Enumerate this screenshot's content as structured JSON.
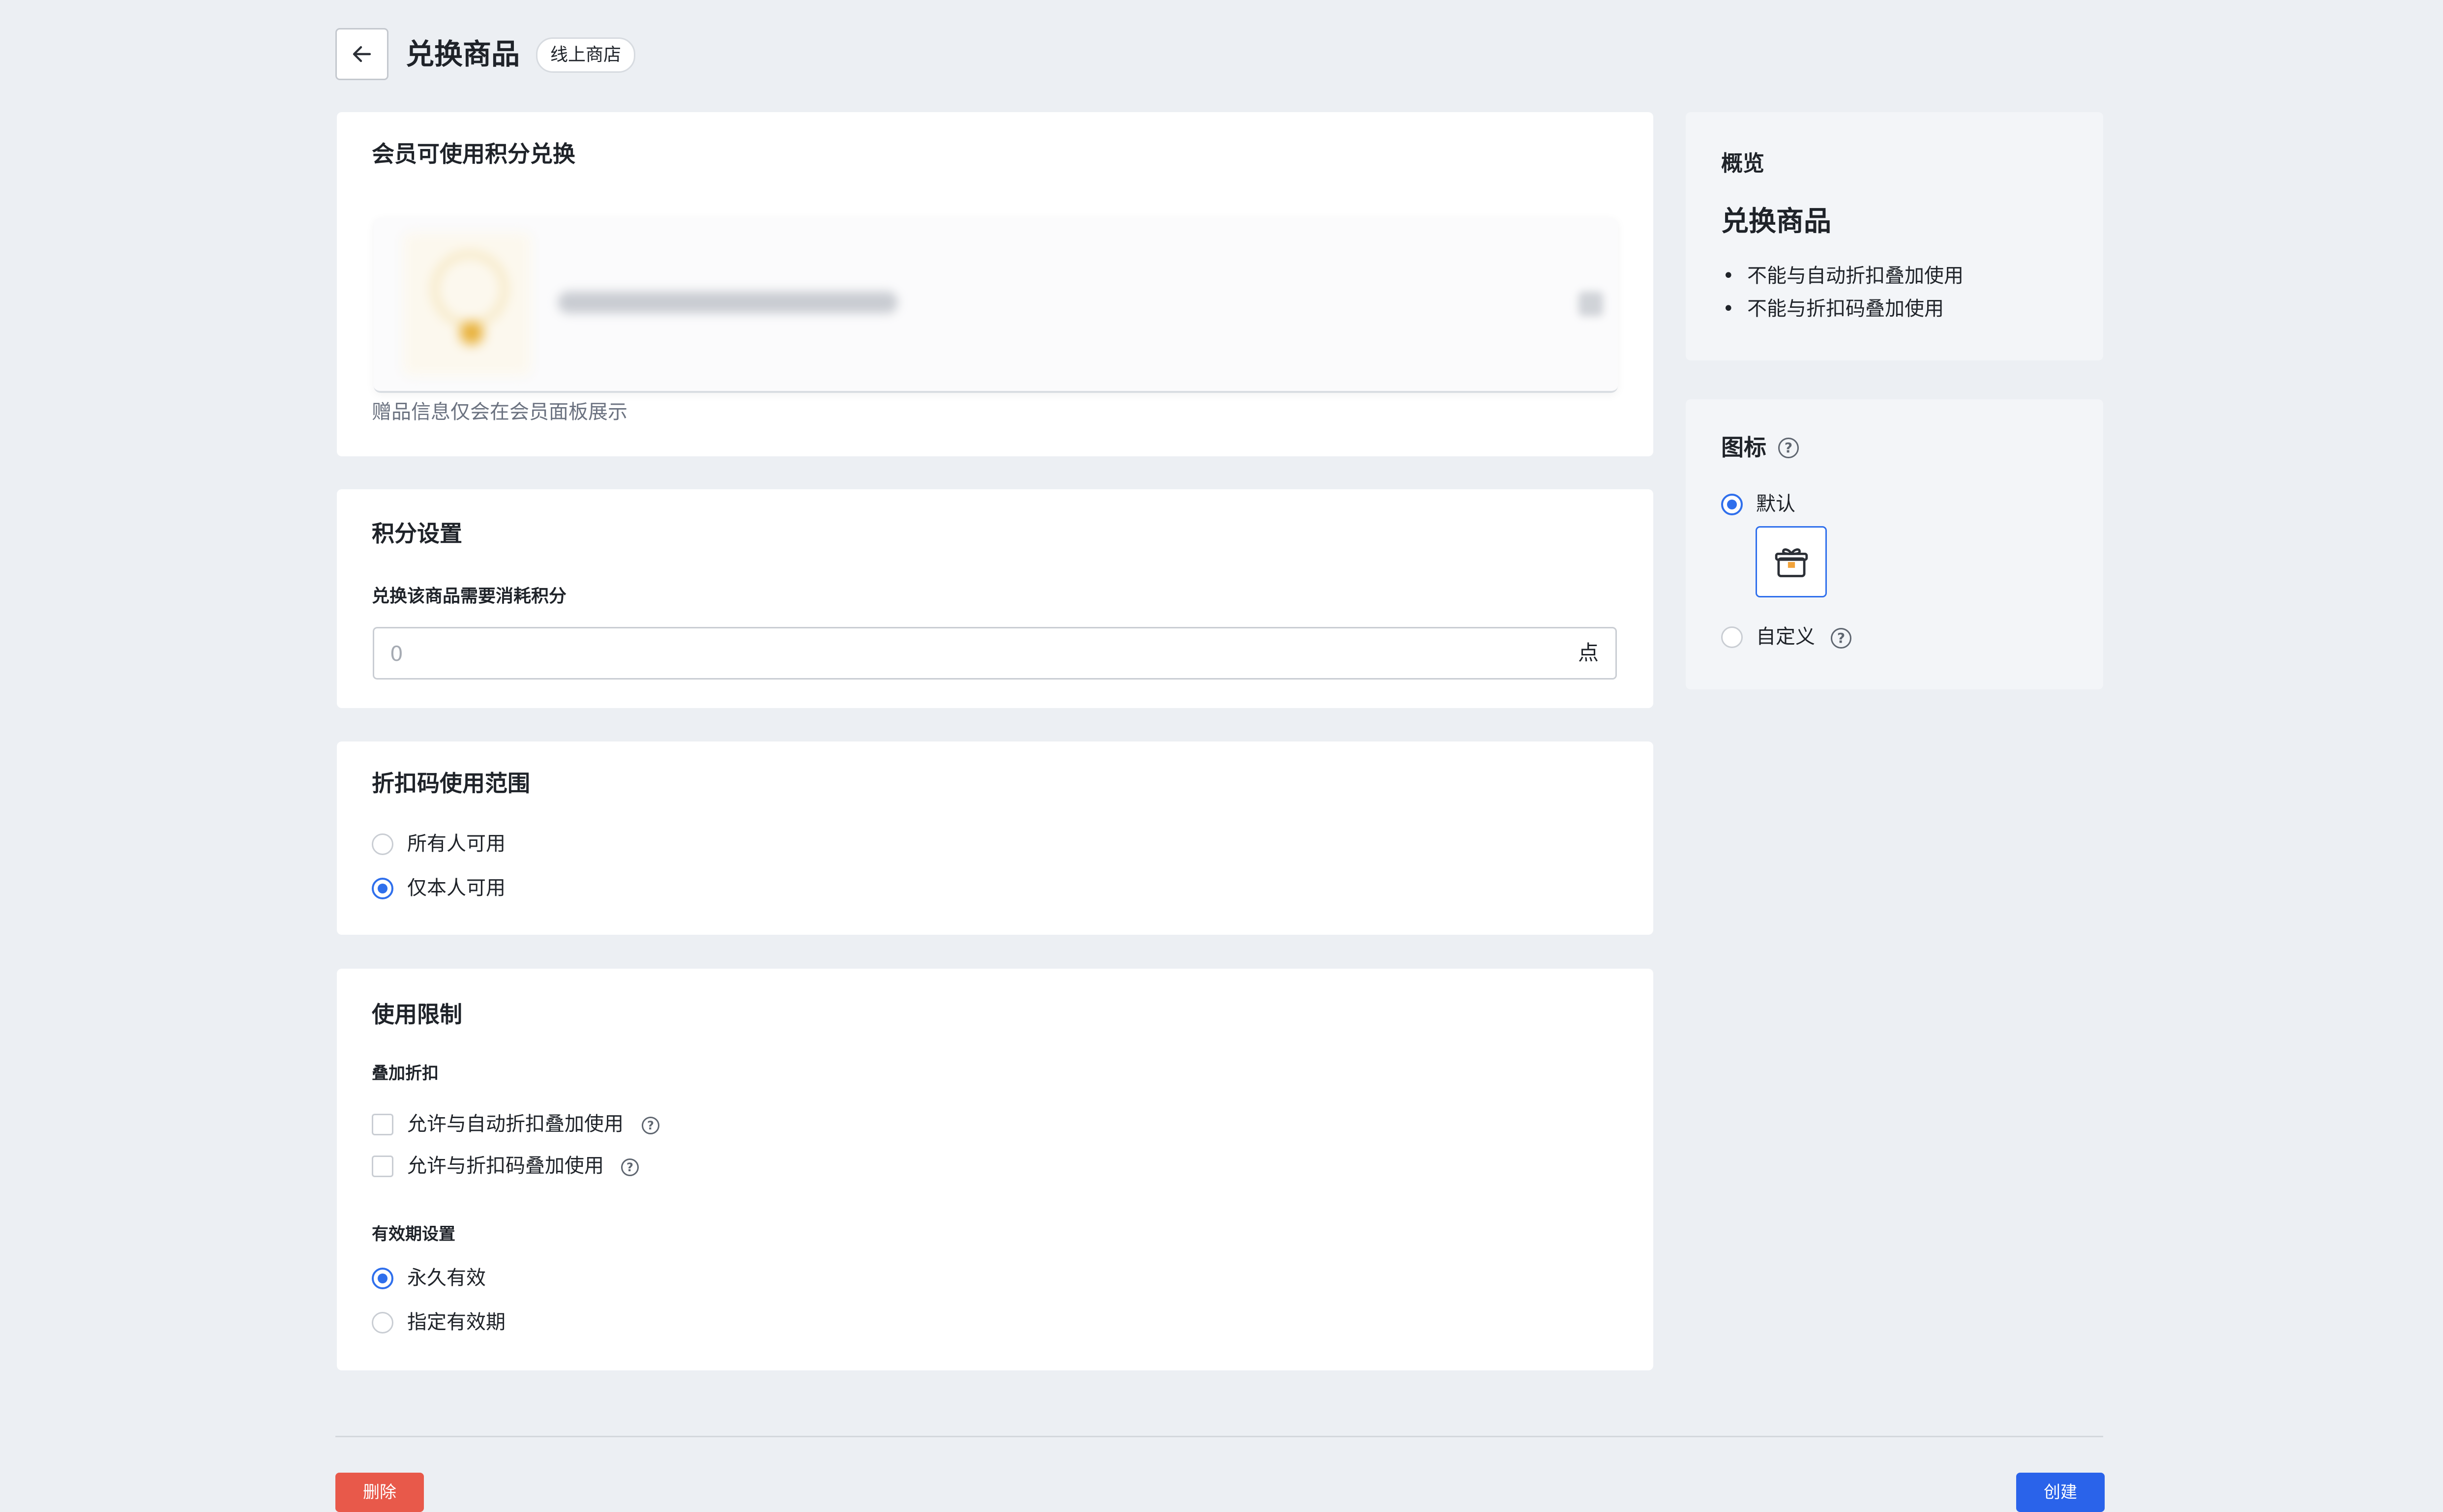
{
  "header": {
    "title": "兑换商品",
    "badge": "线上商店"
  },
  "redeem_card": {
    "title": "会员可使用积分兑换",
    "hint": "赠品信息仅会在会员面板展示"
  },
  "points_card": {
    "title": "积分设置",
    "field_label": "兑换该商品需要消耗积分",
    "field_placeholder": "0",
    "field_suffix": "点"
  },
  "scope_card": {
    "title": "折扣码使用范围",
    "options": [
      {
        "label": "所有人可用",
        "selected": false
      },
      {
        "label": "仅本人可用",
        "selected": true
      }
    ]
  },
  "limits_card": {
    "title": "使用限制",
    "stack_label": "叠加折扣",
    "stack_options": [
      {
        "label": "允许与自动折扣叠加使用",
        "checked": false
      },
      {
        "label": "允许与折扣码叠加使用",
        "checked": false
      }
    ],
    "validity_label": "有效期设置",
    "validity_options": [
      {
        "label": "永久有效",
        "selected": true
      },
      {
        "label": "指定有效期",
        "selected": false
      }
    ]
  },
  "overview": {
    "heading": "概览",
    "title": "兑换商品",
    "bullets": [
      "不能与自动折扣叠加使用",
      "不能与折扣码叠加使用"
    ]
  },
  "icon_card": {
    "title": "图标",
    "default_label": "默认",
    "custom_label": "自定义",
    "default_selected": true,
    "tile_icon": "gift-box-icon"
  },
  "footer": {
    "delete_label": "删除",
    "create_label": "创建"
  },
  "colors": {
    "accent": "#2f6fec",
    "danger": "#e8594a",
    "page_bg": "#eceff3"
  }
}
